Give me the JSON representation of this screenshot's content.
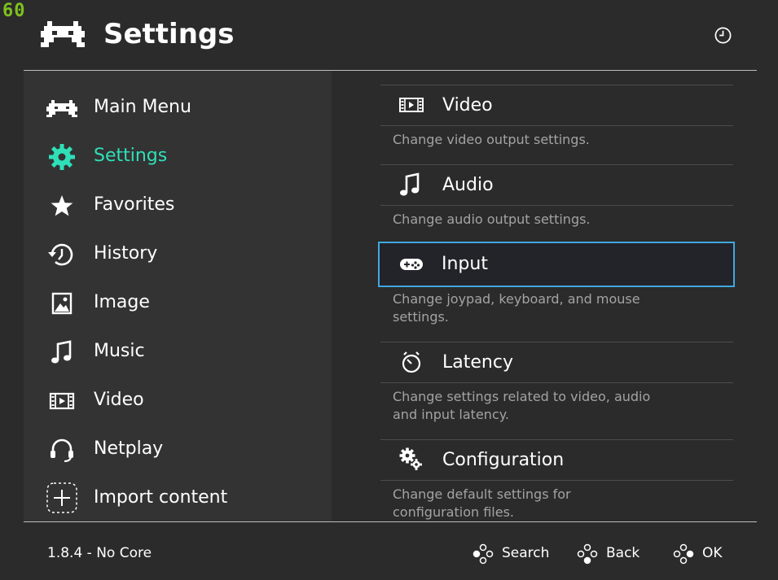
{
  "fps": "60",
  "header": {
    "title": "Settings"
  },
  "sidebar": {
    "items": [
      {
        "label": "Main Menu",
        "icon": "retroarch-invader-icon"
      },
      {
        "label": "Settings",
        "icon": "gear-icon",
        "active": true
      },
      {
        "label": "Favorites",
        "icon": "star-icon"
      },
      {
        "label": "History",
        "icon": "history-icon"
      },
      {
        "label": "Image",
        "icon": "image-icon"
      },
      {
        "label": "Music",
        "icon": "music-note-icon"
      },
      {
        "label": "Video",
        "icon": "film-icon"
      },
      {
        "label": "Netplay",
        "icon": "headset-icon"
      },
      {
        "label": "Import content",
        "icon": "plus-icon"
      }
    ]
  },
  "content": {
    "entries": [
      {
        "label": "Video",
        "desc": "Change video output settings.",
        "icon": "film-icon"
      },
      {
        "label": "Audio",
        "desc": "Change audio output settings.",
        "icon": "music-note-icon"
      },
      {
        "label": "Input",
        "desc1": "Change joypad, keyboard, and mouse",
        "desc2": "settings.",
        "icon": "gamepad-icon",
        "selected": true
      },
      {
        "label": "Latency",
        "desc1": "Change settings related to video, audio",
        "desc2": "and input latency.",
        "icon": "stopwatch-icon"
      },
      {
        "label": "Configuration",
        "desc1": "Change default settings for",
        "desc2": "configuration files.",
        "icon": "gears-icon"
      }
    ]
  },
  "footer": {
    "version": "1.8.4 - No Core",
    "buttons": [
      {
        "label": "Search"
      },
      {
        "label": "Back"
      },
      {
        "label": "OK"
      }
    ]
  },
  "colors": {
    "accent": "#2ee0b8",
    "selection": "#3fa9df",
    "fps": "#7ec01e"
  }
}
